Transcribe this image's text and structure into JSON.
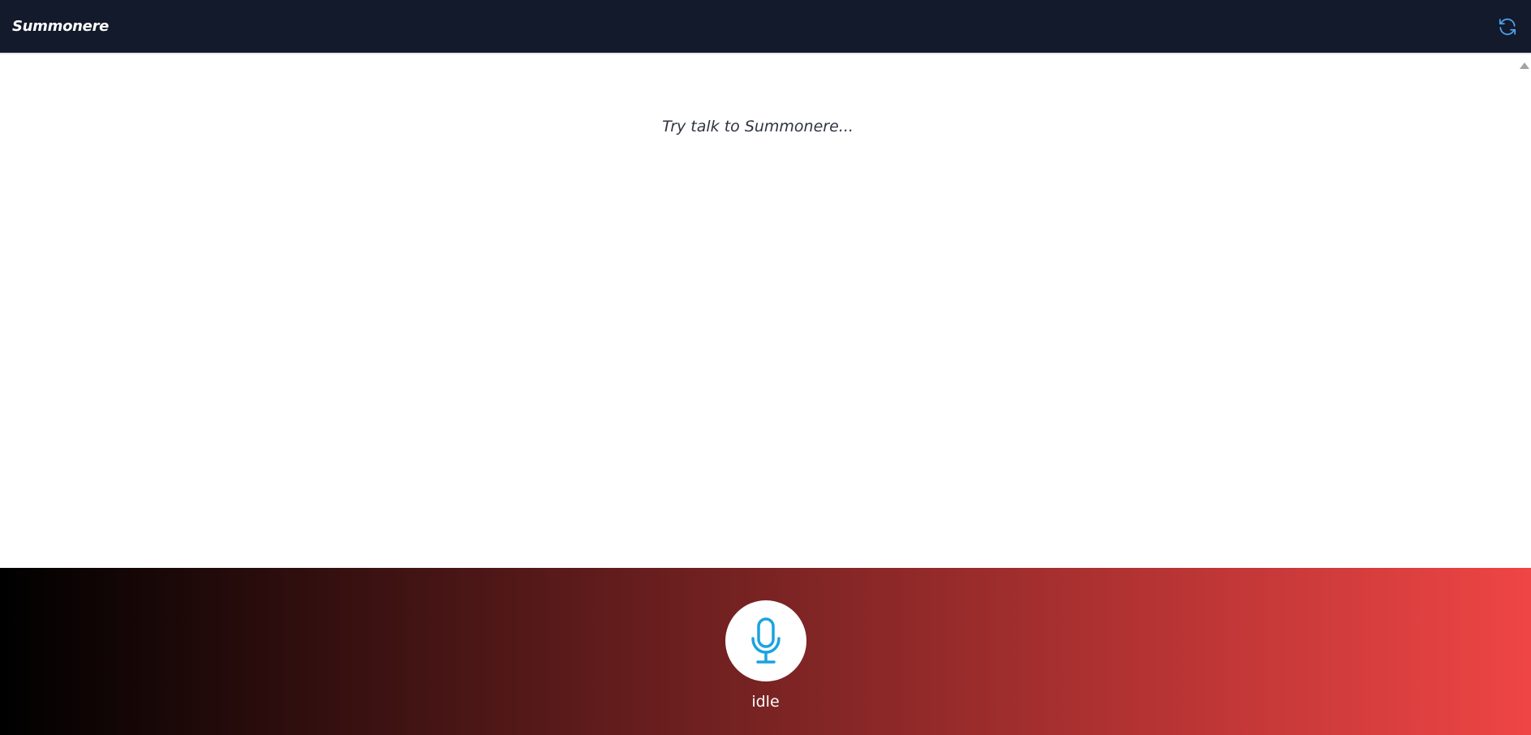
{
  "header": {
    "title": "Summonere",
    "refresh_icon": "refresh-icon"
  },
  "main": {
    "placeholder": "Try talk to Summonere..."
  },
  "footer": {
    "mic_icon": "microphone-icon",
    "status": "idle"
  },
  "colors": {
    "header_bg": "#131a2b",
    "accent": "#1aa3e0",
    "footer_gradient": [
      "#000000",
      "#ef4545"
    ]
  }
}
